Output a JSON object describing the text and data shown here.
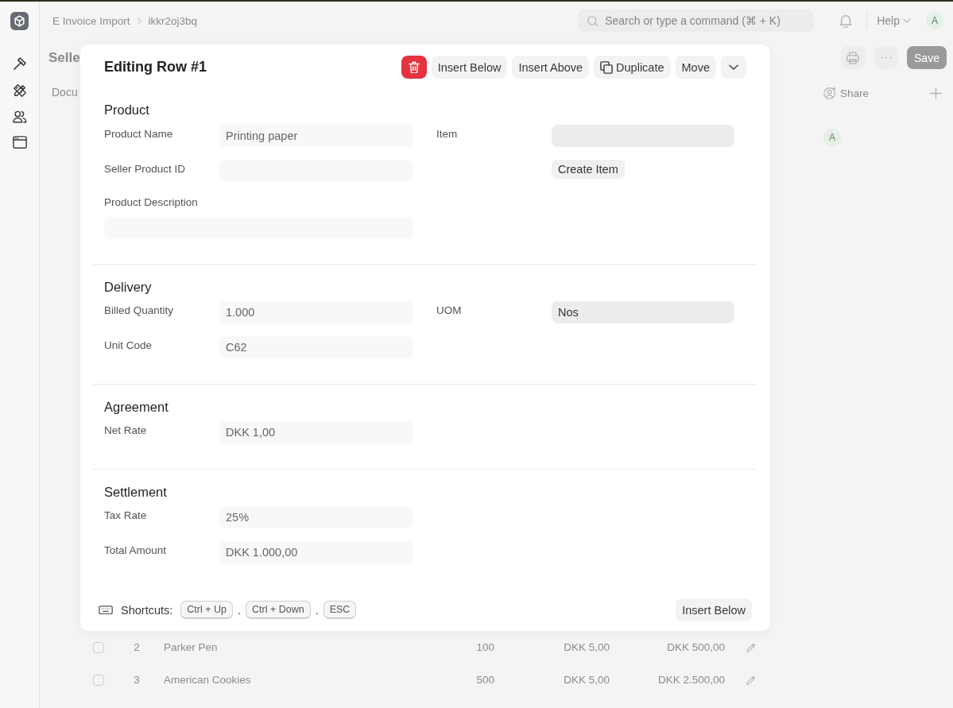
{
  "topbar": {
    "breadcrumbs": [
      "E Invoice Import",
      "ikkr2oj3bq"
    ],
    "search": {
      "placeholder": "Search or type a command (⌘ + K)"
    },
    "help": "Help",
    "avatar": "A"
  },
  "page": {
    "title": "Selle",
    "save_button": "Save",
    "tab": "Docu",
    "share": "Share",
    "assignee_avatar": "A"
  },
  "dialog": {
    "title": "Editing Row #1",
    "actions": [
      {
        "kind": "delete"
      },
      {
        "kind": "text",
        "label": "Insert Below"
      },
      {
        "kind": "text",
        "label": "Insert Above"
      },
      {
        "kind": "copy",
        "label": "Duplicate"
      },
      {
        "kind": "text",
        "label": "Move"
      },
      {
        "kind": "dropdown"
      }
    ],
    "sections": [
      {
        "title": "Product",
        "columns": [
          [
            {
              "kind": "input",
              "label": "Product Name",
              "value": "Printing paper",
              "read_only": true
            },
            {
              "kind": "input",
              "label": "Seller Product ID",
              "read_only": true
            },
            {
              "kind": "textarea",
              "label": "Product Description",
              "read_only": true
            }
          ],
          [
            {
              "kind": "input",
              "label": "Item",
              "read_only": false
            },
            {
              "kind": "button",
              "label": "Create Item"
            }
          ]
        ]
      },
      {
        "title": "Delivery",
        "columns": [
          [
            {
              "kind": "input",
              "label": "Billed Quantity",
              "value": "1.000",
              "read_only": true
            },
            {
              "kind": "input",
              "label": "Unit Code",
              "value": "C62",
              "read_only": true
            }
          ],
          [
            {
              "kind": "input",
              "label": "UOM",
              "value": "Nos",
              "read_only": false
            }
          ]
        ]
      },
      {
        "title": "Agreement",
        "columns": [
          [
            {
              "kind": "input",
              "label": "Net Rate",
              "value": "DKK 1,00",
              "read_only": true
            }
          ]
        ]
      },
      {
        "title": "Settlement",
        "columns": [
          [
            {
              "kind": "input",
              "label": "Tax Rate",
              "value": "25%",
              "read_only": true
            },
            {
              "kind": "input",
              "label": "Total Amount",
              "value": "DKK 1.000,00",
              "read_only": true
            }
          ]
        ]
      }
    ],
    "footer": {
      "label": "Shortcuts:",
      "keys": [
        {
          "kind": "key",
          "text": "Ctrl + Up"
        },
        {
          "kind": "separator",
          "text": "."
        },
        {
          "kind": "key",
          "text": "Ctrl + Down"
        },
        {
          "kind": "separator",
          "text": "."
        },
        {
          "kind": "key",
          "text": "ESC"
        }
      ],
      "button": "Insert Below"
    }
  },
  "table": {
    "rows": [
      {
        "checked": false,
        "cells": [
          "2",
          "Parker Pen",
          "100",
          "DKK 5,00",
          "DKK 500,00"
        ]
      },
      {
        "checked": false,
        "cells": [
          "3",
          "American Cookies",
          "500",
          "DKK 5,00",
          "DKK 2.500,00"
        ]
      }
    ]
  }
}
